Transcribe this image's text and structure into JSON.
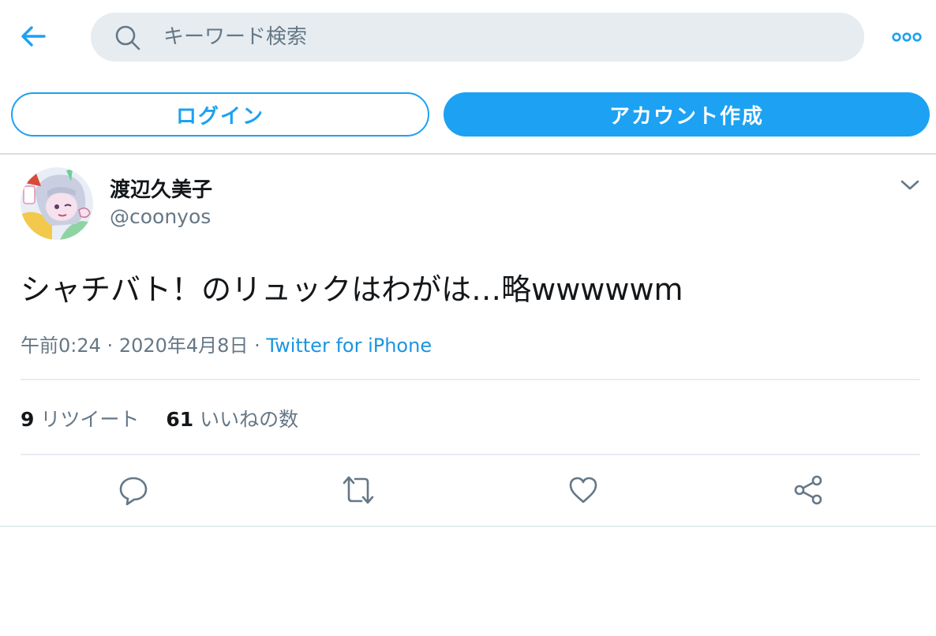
{
  "search": {
    "placeholder": "キーワード検索"
  },
  "auth": {
    "login_label": "ログイン",
    "signup_label": "アカウント作成"
  },
  "tweet": {
    "display_name": "渡辺久美子",
    "handle": "@coonyos",
    "text": "シャチバト！のリュックはわがは…略wwwwwm",
    "time": "午前0:24",
    "date": "2020年4月8日",
    "separator": "·",
    "source": "Twitter for iPhone",
    "retweet_count": "9",
    "retweet_label": "リツイート",
    "like_count": "61",
    "like_label": "いいねの数"
  },
  "icons": [
    "back-arrow-icon",
    "search-icon",
    "more-icon",
    "caret-down-icon",
    "reply-icon",
    "retweet-icon",
    "like-icon",
    "share-icon"
  ],
  "colors": {
    "accent": "#1da1f2",
    "link": "#1b95e0",
    "muted": "#657786",
    "search_bg": "#e6ecf0"
  }
}
